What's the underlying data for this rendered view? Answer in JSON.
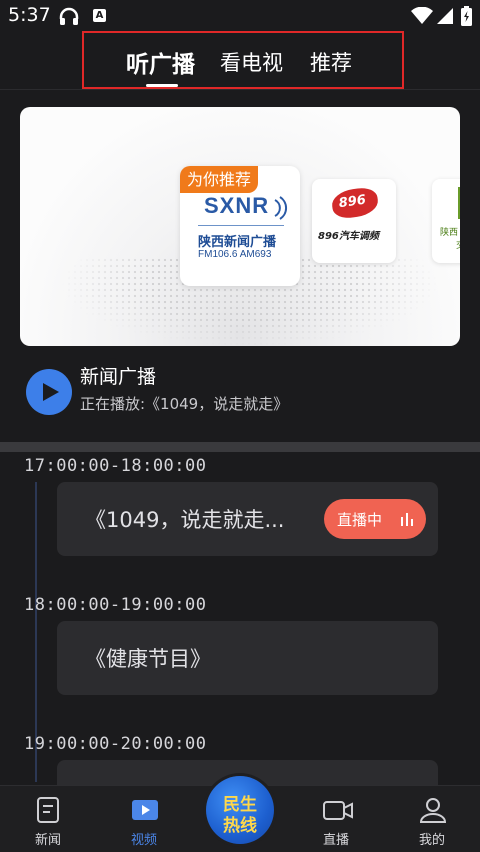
{
  "status_bar": {
    "time": "5:37",
    "icons": [
      "headphones-icon",
      "a-icon",
      "wifi-icon",
      "signal-icon",
      "battery-icon"
    ],
    "a_label": "A"
  },
  "tabs": {
    "items": [
      {
        "label": "听广播",
        "active": true
      },
      {
        "label": "看电视",
        "active": false
      },
      {
        "label": "推荐",
        "active": false
      }
    ]
  },
  "banner": {
    "recommend_tag": "为你推荐",
    "main_card": {
      "logo_text": "SXNR",
      "station_name": "陕西新闻广播",
      "frequency": "FM106.6 AM693"
    },
    "second_card": {
      "logo_text": "896",
      "name": "896汽车调频"
    },
    "third_card": {
      "name": "陕西",
      "name2": "交"
    }
  },
  "now_playing": {
    "channel": "新闻广播",
    "playing_text": "正在播放:《1049，说走就走》"
  },
  "schedule": [
    {
      "time": "17:00:00-18:00:00",
      "title": "《1049，说走就走...",
      "live": true,
      "live_label": "直播中"
    },
    {
      "time": "18:00:00-19:00:00",
      "title": "《健康节目》",
      "live": false
    },
    {
      "time": "19:00:00-20:00:00",
      "title": "",
      "live": false
    }
  ],
  "bottom_nav": {
    "items": [
      {
        "label": "新闻",
        "icon": "news-icon",
        "active": false
      },
      {
        "label": "视频",
        "icon": "video-icon",
        "active": true
      },
      {
        "label": "直播",
        "icon": "live-camera-icon",
        "active": false
      },
      {
        "label": "我的",
        "icon": "profile-icon",
        "active": false
      }
    ],
    "hotline_line1": "民生",
    "hotline_line2": "热线"
  },
  "colors": {
    "background": "#1b1b1d",
    "accent_blue": "#3d7fe9",
    "live_red": "#f06352",
    "recommend_orange": "#f07a1a",
    "highlight_border": "#e02828"
  }
}
